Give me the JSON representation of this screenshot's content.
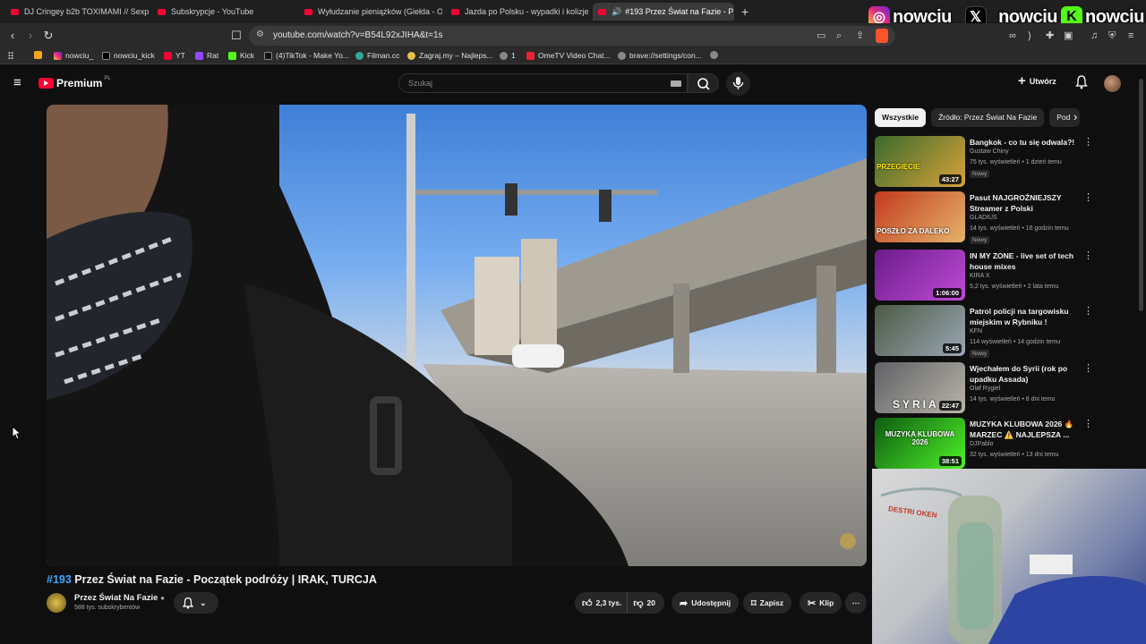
{
  "tabs": [
    {
      "label": "DJ Cringey b2b TOXIMAMI // Sexpre"
    },
    {
      "label": "Subskrypcje - YouTube"
    },
    {
      "label": "Wyłudzanie pieniążków (Giełda - Od"
    },
    {
      "label": "Jazda po Polsku - wypadki i kolizje d"
    },
    {
      "label": "#193 Przez Świat na Fazie - P"
    }
  ],
  "address": {
    "url": "youtube.com/watch?v=B54L92xJIHA&t=1s"
  },
  "bookmarks": [
    {
      "label": "nowciu_"
    },
    {
      "label": "nowciu_kick"
    },
    {
      "label": "YT"
    },
    {
      "label": "Rat"
    },
    {
      "label": "Kick"
    },
    {
      "label": "(4)TikTok - Make Yo..."
    },
    {
      "label": "Filman.cc"
    },
    {
      "label": "Zagraj.my – Najleps..."
    },
    {
      "label": "1"
    },
    {
      "label": "OmeTV Video Chat..."
    },
    {
      "label": "brave://settings/con..."
    }
  ],
  "social": [
    {
      "name": "nowciu_",
      "icon": "instagram-icon",
      "color": "#e1306c"
    },
    {
      "name": "_nowciu",
      "icon": "x-icon",
      "color": "#000000"
    },
    {
      "name": "nowciu",
      "icon": "kick-icon",
      "color": "#53fc18"
    }
  ],
  "header": {
    "logo": "Premium",
    "region": "PL",
    "search_placeholder": "Szukaj",
    "create_label": "Utwórz"
  },
  "chips": [
    "Wszystkie",
    "Źródło: Przez Świat Na Fazie",
    "Pod"
  ],
  "recommendations": [
    {
      "title": "Bangkok - co tu się odwala?!",
      "channel": "Gustaw Chiny",
      "meta": "75 tys. wyświetleń • 1 dzień temu",
      "badge": "Nowy",
      "duration": "43:27",
      "thumb_text": "PRZEGIĘCIE",
      "colors": [
        "#3b6b2a",
        "#d7a23b"
      ]
    },
    {
      "title": "Pasut NAJGROŹNIEJSZY Streamer z Polski",
      "channel": "GLADIUS",
      "meta": "14 tys. wyświetleń • 16 godzin temu",
      "badge": "Nowy",
      "duration": "",
      "thumb_text": "POSZŁO ZA DALEKO",
      "colors": [
        "#c23a1e",
        "#e5b36a"
      ]
    },
    {
      "title": "IN MY ZONE - live set of tech house mixes",
      "channel": "KIRA X",
      "meta": "5,2 tys. wyświetleń • 2 lata temu",
      "badge": "",
      "duration": "1:06:00",
      "thumb_text": "",
      "colors": [
        "#6a1b8a",
        "#c04bd6"
      ]
    },
    {
      "title": "Patrol policji na targowisku miejskim w Rybniku ! archiwu...",
      "channel": "KFN",
      "meta": "114 wyświetleń • 14 godzin temu",
      "badge": "Nowy",
      "duration": "5:45",
      "thumb_text": "",
      "colors": [
        "#4c5a44",
        "#9aa7b6"
      ]
    },
    {
      "title": "Wjechałem do Syrii (rok po upadku Assada)",
      "channel": "Olaf Rygiel",
      "meta": "14 tys. wyświetleń • 8 dni temu",
      "badge": "",
      "duration": "22:47",
      "thumb_text": "SYRIA",
      "colors": [
        "#5f6166",
        "#b9b4a8"
      ]
    },
    {
      "title": "MUZYKA KLUBOWA 2026 🔥 MARZEC ⚠️ NAJLEPSZA ...",
      "channel": "DJPablo",
      "meta": "32 tys. wyświetleń • 13 dni temu",
      "badge": "",
      "duration": "38:51",
      "thumb_text": "MUZYKA KLUBOWA 2026",
      "colors": [
        "#0f5b12",
        "#4df227"
      ]
    }
  ],
  "video": {
    "title_num": "#193",
    "title": "Przez Świat na Fazie - Początek podróży | IRAK, TURCJA",
    "channel": "Przez Świat Na Fazie",
    "subscribers": "588 tys. subskrybentów",
    "likes": "2,3 tys.",
    "dislikes": "20",
    "share_label": "Udostępnij",
    "save_label": "Zapisz",
    "clip_label": "Klip"
  },
  "webcam": {
    "overlay_text": "DESTRI OKEN"
  }
}
